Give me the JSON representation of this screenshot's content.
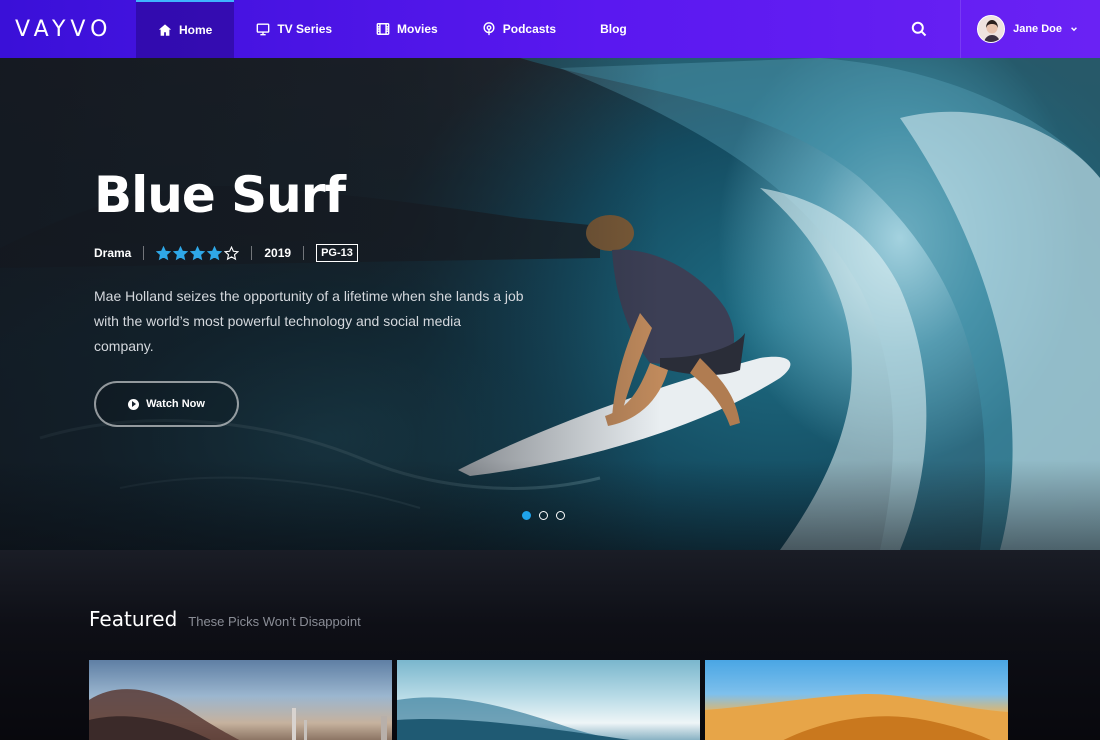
{
  "brand": {
    "logo": "VAYVO"
  },
  "nav": {
    "items": [
      {
        "label": "Home",
        "icon": "home-icon",
        "active": true
      },
      {
        "label": "TV Series",
        "icon": "tv-icon"
      },
      {
        "label": "Movies",
        "icon": "film-icon"
      },
      {
        "label": "Podcasts",
        "icon": "podcast-icon"
      },
      {
        "label": "Blog"
      }
    ]
  },
  "user": {
    "name": "Jane Doe"
  },
  "hero": {
    "title": "Blue Surf",
    "genre": "Drama",
    "stars_filled": 4,
    "stars_total": 5,
    "year": "2019",
    "rating": "PG-13",
    "description": "Mae Holland seizes the opportunity of a lifetime when she lands a job with the world’s most powerful technology and social media company.",
    "cta": "Watch Now",
    "slides": 3,
    "active_slide": 1
  },
  "featured": {
    "title": "Featured",
    "subtitle": "These Picks Won’t Disappoint"
  },
  "colors": {
    "nav_gradient_start": "#3a10d8",
    "nav_gradient_end": "#6a22f4",
    "accent": "#1fa3ea",
    "star": "#2fa8e8"
  }
}
